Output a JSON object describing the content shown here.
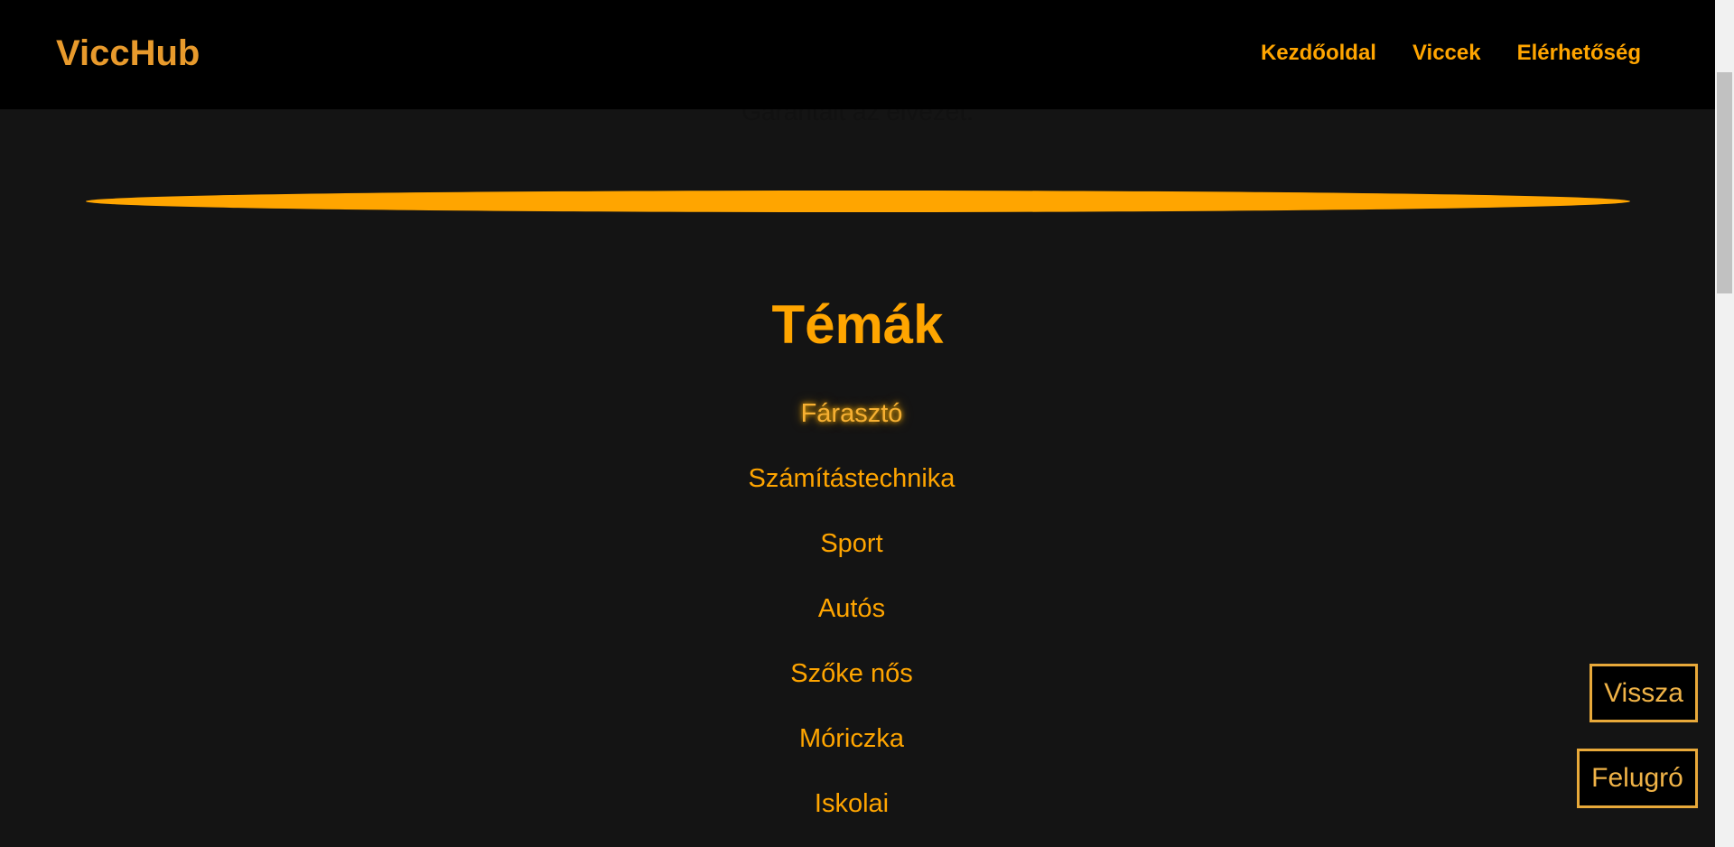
{
  "header": {
    "brand": "ViccHub",
    "nav": [
      {
        "label": "Kezdőoldal"
      },
      {
        "label": "Viccek"
      },
      {
        "label": "Elérhetőség"
      }
    ]
  },
  "intro": {
    "text": "Garantált az élvezet."
  },
  "topics": {
    "title": "Témák",
    "items": [
      {
        "label": "Fárasztó"
      },
      {
        "label": "Számítástechnika"
      },
      {
        "label": "Sport"
      },
      {
        "label": "Autós"
      },
      {
        "label": "Szőke nős"
      },
      {
        "label": "Móriczka"
      },
      {
        "label": "Iskolai"
      }
    ]
  },
  "floating_buttons": {
    "back_label": "Vissza",
    "popup_label": "Felugró"
  },
  "colors": {
    "accent": "#ffa500",
    "brand": "#e89a2c",
    "header_bg": "#000000",
    "page_bg": "#141414"
  }
}
